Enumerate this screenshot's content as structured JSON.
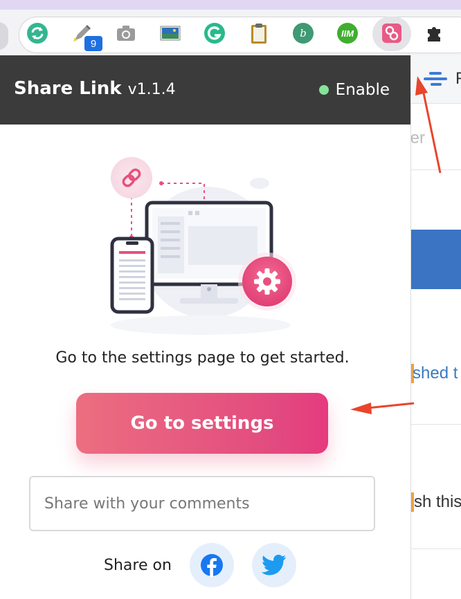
{
  "extensions": {
    "badge_count": "9",
    "bookmark_letter": "b",
    "im_label": "IIM",
    "g_letter": "G"
  },
  "background_page": {
    "text_top": "ter",
    "text_middle": "shed t",
    "text_bottom": "sh this",
    "header_letter": "F"
  },
  "popup": {
    "title": "Share Link",
    "version": "v1.1.4",
    "status_label": "Enable",
    "status_color": "#86e39a",
    "message": "Go to the settings page to get started.",
    "cta_label": "Go to settings",
    "comment_placeholder": "Share with your comments",
    "share_label": "Share on",
    "social": [
      "facebook",
      "twitter"
    ]
  },
  "colors": {
    "accent": "#e24a7f",
    "header_bg": "#3b3b3b",
    "annotation_arrow": "#e8452c"
  }
}
